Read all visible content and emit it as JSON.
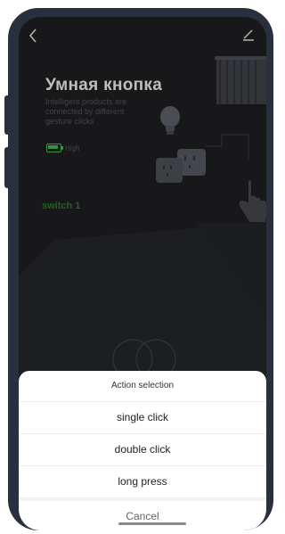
{
  "device": {
    "title": "Умная кнопка",
    "description": "Intelligent products are connected by different gesture clicks",
    "battery_label": "High",
    "switch_label": "switch 1"
  },
  "action_sheet": {
    "title": "Action selection",
    "options": [
      "single click",
      "double click",
      "long press"
    ],
    "cancel_label": "Cancel"
  },
  "colors": {
    "battery_green": "#3fa84a",
    "switch_label_green": "#2a6b2f"
  },
  "icons": {
    "back": "chevron-left-icon",
    "edit": "edit-icon"
  }
}
